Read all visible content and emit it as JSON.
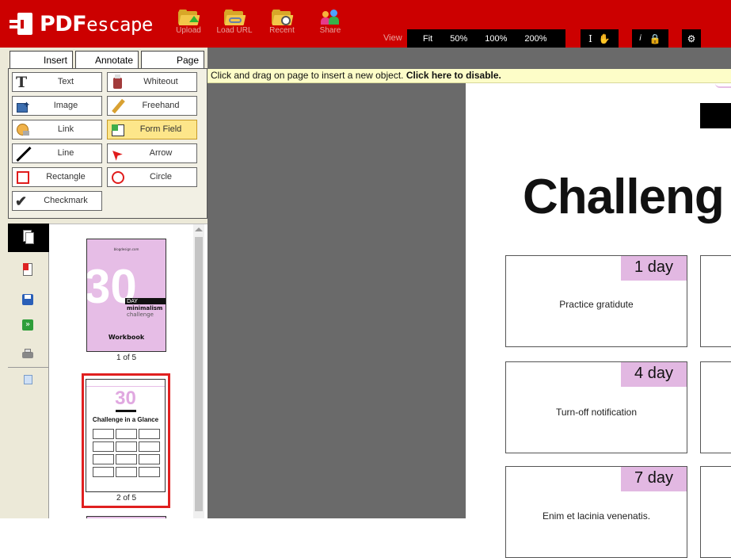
{
  "app": {
    "brand_bold": "PDF",
    "brand_thin": "escape"
  },
  "toolbar": {
    "tools": [
      {
        "label": "Upload",
        "icon": "folder-upload-icon"
      },
      {
        "label": "Load URL",
        "icon": "folder-link-icon"
      },
      {
        "label": "Recent",
        "icon": "folder-clock-icon"
      },
      {
        "label": "Share",
        "icon": "people-icon"
      }
    ],
    "view_label": "View",
    "zoom_options": [
      "Fit",
      "50%",
      "100%",
      "200%"
    ]
  },
  "tabs": {
    "insert": "Insert",
    "annotate": "Annotate",
    "page": "Page"
  },
  "insert_buttons": [
    {
      "label": "Text"
    },
    {
      "label": "Whiteout"
    },
    {
      "label": "Image"
    },
    {
      "label": "Freehand"
    },
    {
      "label": "Link"
    },
    {
      "label": "Form Field"
    },
    {
      "label": "Line"
    },
    {
      "label": "Arrow"
    },
    {
      "label": "Rectangle"
    },
    {
      "label": "Circle"
    },
    {
      "label": "Checkmark"
    }
  ],
  "notice": {
    "text": "Click and drag on page to insert a new object. ",
    "link": "Click here to disable."
  },
  "thumbnails": {
    "page1": {
      "site": "blogdesign.com",
      "big": "30",
      "day": "DAY",
      "line1": "minimalism",
      "line2": "challenge",
      "footer": "Workbook",
      "label": "1 of 5"
    },
    "page2": {
      "big": "30",
      "title": "Challenge in a Glance",
      "label": "2 of 5"
    }
  },
  "document": {
    "title": "Challeng",
    "cards": [
      {
        "day": "1 day",
        "text": "Practice gratidute"
      },
      {
        "day": "4 day",
        "text": "Turn-off notification"
      },
      {
        "day": "7 day",
        "text": "Enim et lacinia venenatis."
      }
    ]
  },
  "colors": {
    "brand_red": "#cc0000",
    "badge_pink": "#e2b8e2",
    "active_yellow": "#fde68a"
  }
}
